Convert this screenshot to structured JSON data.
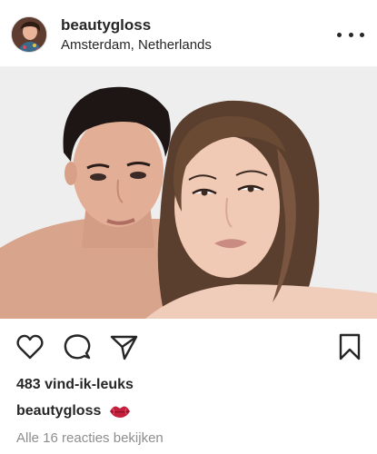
{
  "post": {
    "username": "beautygloss",
    "location": "Amsterdam, Netherlands",
    "likes_text": "483 vind-ik-leuks",
    "caption_username": "beautygloss",
    "caption_emoji": "lips-kiss-mark",
    "comments_link": "Alle 16 reacties bekijken"
  },
  "icons": {
    "more": "more-options-icon",
    "like": "heart-icon",
    "comment": "comment-bubble-icon",
    "share": "paper-plane-icon",
    "save": "bookmark-icon"
  },
  "colors": {
    "text": "#262626",
    "muted": "#8e8e8e",
    "lips": "#c4203c",
    "background": "#ffffff"
  }
}
